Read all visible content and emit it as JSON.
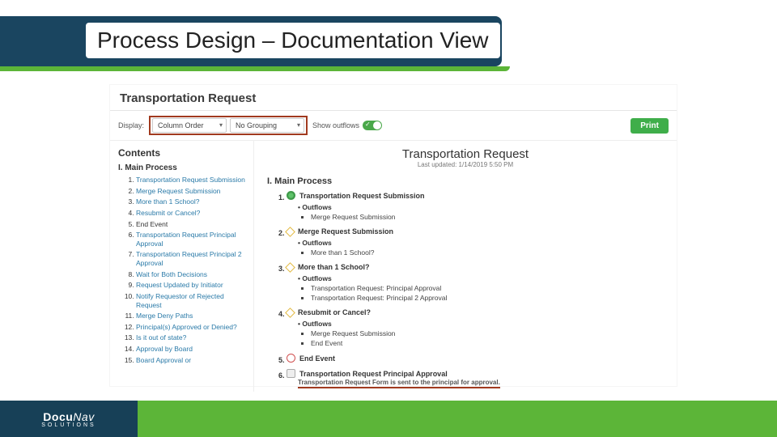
{
  "slide": {
    "title": "Process Design – Documentation View"
  },
  "app": {
    "title": "Transportation Request",
    "toolbar": {
      "display_label": "Display:",
      "column_order": "Column Order",
      "grouping": "No Grouping",
      "show_outflows": "Show outflows",
      "print": "Print"
    },
    "contents": {
      "heading": "Contents",
      "group": "I. Main Process",
      "items": [
        {
          "n": 1,
          "label": "Transportation Request Submission",
          "link": true
        },
        {
          "n": 2,
          "label": "Merge Request Submission",
          "link": true
        },
        {
          "n": 3,
          "label": "More than 1 School?",
          "link": true
        },
        {
          "n": 4,
          "label": "Resubmit or Cancel?",
          "link": true
        },
        {
          "n": 5,
          "label": "End Event",
          "link": false
        },
        {
          "n": 6,
          "label": "Transportation Request Principal Approval",
          "link": true
        },
        {
          "n": 7,
          "label": "Transportation Request Principal 2 Approval",
          "link": true
        },
        {
          "n": 8,
          "label": "Wait for Both Decisions",
          "link": true
        },
        {
          "n": 9,
          "label": "Request Updated by Initiator",
          "link": true
        },
        {
          "n": 10,
          "label": "Notify Requestor of Rejected Request",
          "link": true
        },
        {
          "n": 11,
          "label": "Merge Deny Paths",
          "link": true
        },
        {
          "n": 12,
          "label": "Principal(s) Approved or Denied?",
          "link": true
        },
        {
          "n": 13,
          "label": "Is it out of state?",
          "link": true
        },
        {
          "n": 14,
          "label": "Approval by Board",
          "link": true
        },
        {
          "n": 15,
          "label": "Board Approval or",
          "link": true
        }
      ]
    },
    "main": {
      "title": "Transportation Request",
      "updated": "Last updated: 1/14/2019 5:50 PM",
      "section": "I. Main Process",
      "steps": [
        {
          "icon": "start",
          "label": "Transportation Request Submission",
          "outflows": [
            "Merge Request Submission"
          ]
        },
        {
          "icon": "diamond",
          "label": "Merge Request Submission",
          "outflows": [
            "More than 1 School?"
          ]
        },
        {
          "icon": "diamond",
          "label": "More than 1 School?",
          "outflows": [
            "Transportation Request: Principal Approval",
            "Transportation Request: Principal 2 Approval"
          ]
        },
        {
          "icon": "diamond",
          "label": "Resubmit or Cancel?",
          "outflows": [
            "Merge Request Submission",
            "End Event"
          ]
        },
        {
          "icon": "end",
          "label": "End Event",
          "outflows": []
        },
        {
          "icon": "task",
          "label": "Transportation Request Principal Approval",
          "outflows": [],
          "detail": "Transportation Request Form is sent to the principal for approval."
        }
      ]
    }
  },
  "footer": {
    "logo": "DocuNav",
    "logo_nav": "Nav",
    "logo_pre": "Docu",
    "sub": "SOLUTIONS"
  }
}
